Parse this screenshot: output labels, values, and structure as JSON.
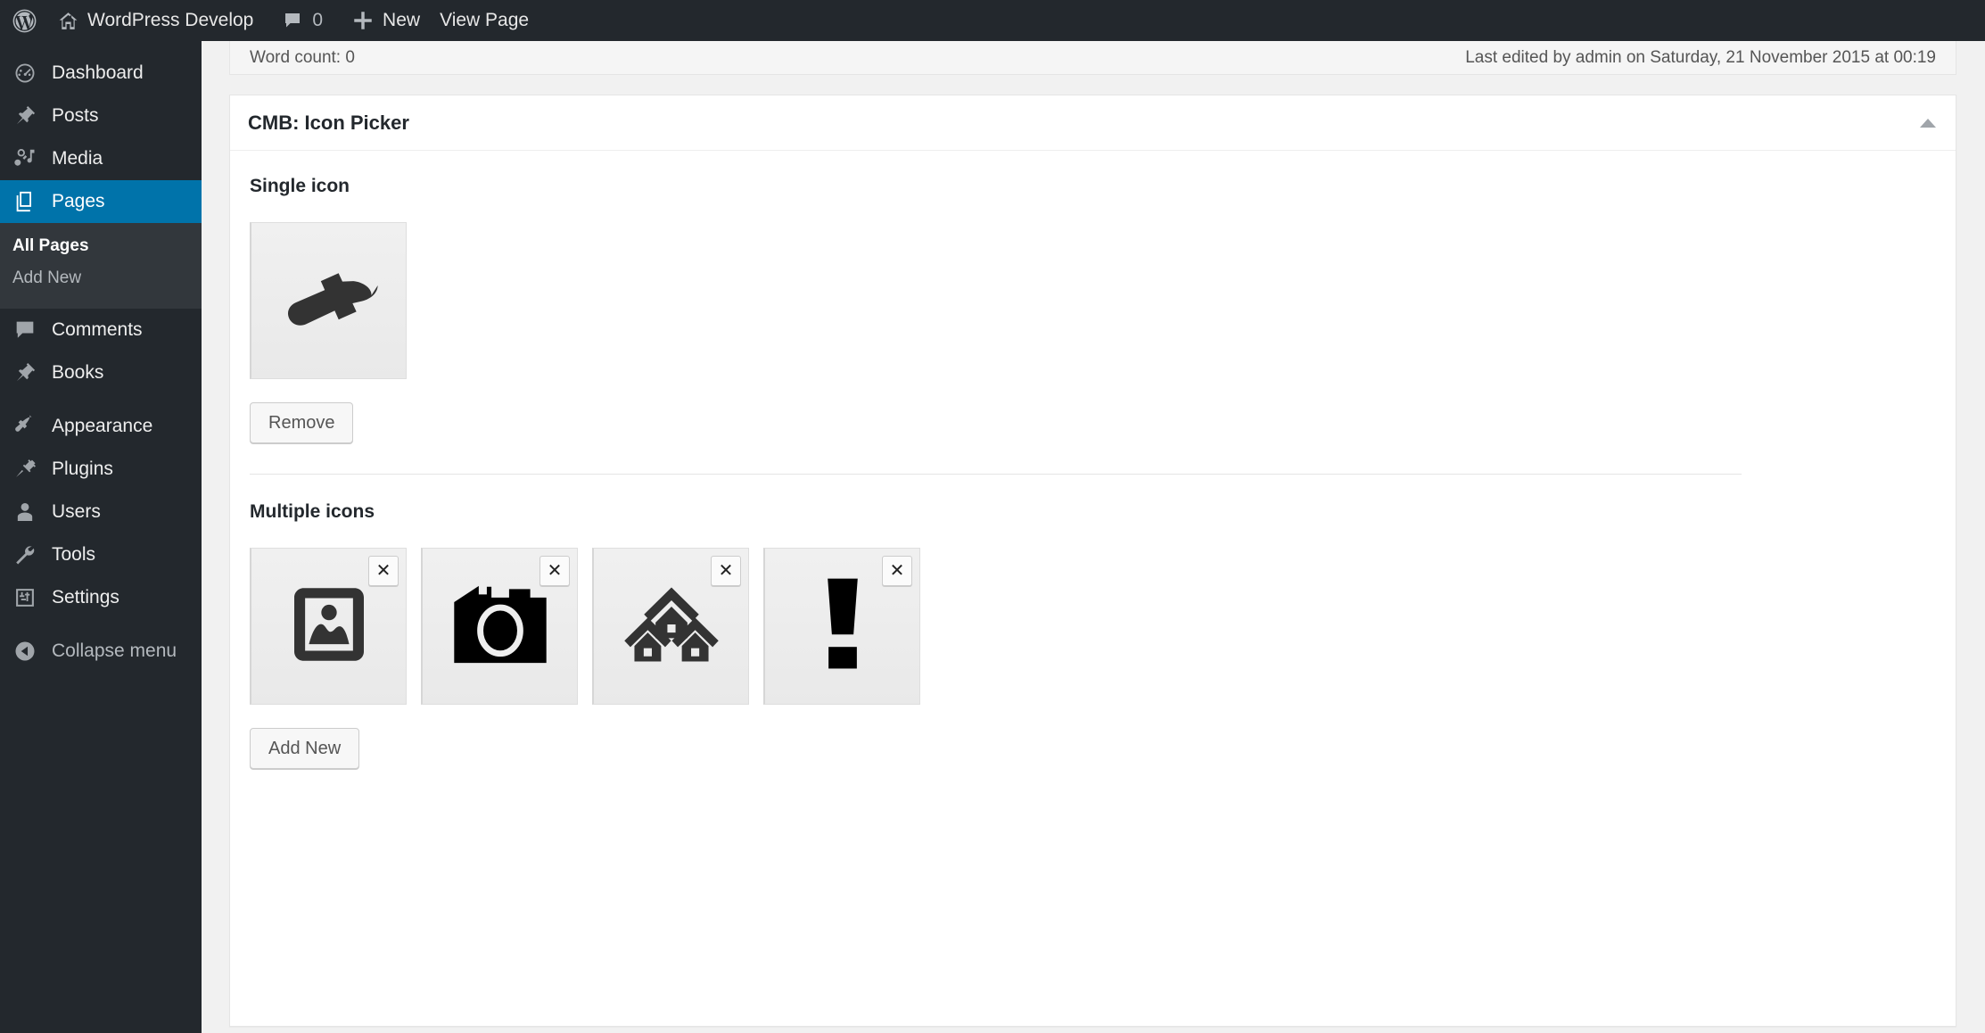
{
  "adminbar": {
    "logo_icon": "wordpress-logo-icon",
    "home_icon": "home-icon",
    "site_title": "WordPress Develop",
    "comment_icon": "comment-bubble-icon",
    "comment_count": "0",
    "new_icon": "plus-icon",
    "new_label": "New",
    "view_page_label": "View Page"
  },
  "sidebar": {
    "items": [
      {
        "label": "Dashboard",
        "icon": "dashboard-icon",
        "current": false
      },
      {
        "label": "Posts",
        "icon": "pin-icon",
        "current": false
      },
      {
        "label": "Media",
        "icon": "media-icon",
        "current": false
      },
      {
        "label": "Pages",
        "icon": "pages-icon",
        "current": true
      },
      {
        "label": "Comments",
        "icon": "comment-bubble-icon",
        "current": false
      },
      {
        "label": "Books",
        "icon": "pin-icon",
        "current": false
      },
      {
        "label": "Appearance",
        "icon": "paintbrush-icon",
        "current": false
      },
      {
        "label": "Plugins",
        "icon": "plug-icon",
        "current": false
      },
      {
        "label": "Users",
        "icon": "user-icon",
        "current": false
      },
      {
        "label": "Tools",
        "icon": "wrench-icon",
        "current": false
      },
      {
        "label": "Settings",
        "icon": "sliders-icon",
        "current": false
      }
    ],
    "submenu": [
      {
        "label": "All Pages",
        "current": true
      },
      {
        "label": "Add New",
        "current": false
      }
    ],
    "collapse": {
      "label": "Collapse menu",
      "icon": "collapse-arrow-icon"
    },
    "highlight_color": "#0073aa"
  },
  "editor_status": {
    "word_count": "Word count: 0",
    "last_edited": "Last edited by admin on Saturday, 21 November 2015 at 00:19"
  },
  "metabox": {
    "title": "CMB: Icon Picker",
    "toggle_icon": "chevron-up-icon",
    "single": {
      "label": "Single icon",
      "icon": "paintbrush-icon",
      "remove_label": "Remove"
    },
    "multiple": {
      "label": "Multiple icons",
      "add_label": "Add New",
      "remove_glyph": "✕",
      "icons": [
        {
          "icon": "image-icon"
        },
        {
          "icon": "camera-icon"
        },
        {
          "icon": "buildings-icon"
        },
        {
          "icon": "exclamation-icon"
        }
      ]
    }
  }
}
